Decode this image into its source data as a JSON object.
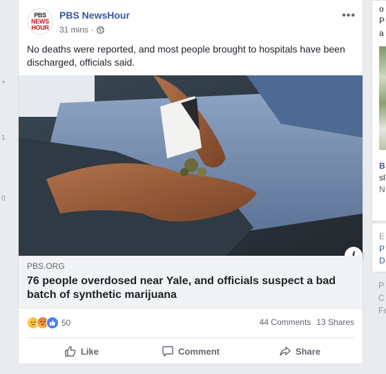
{
  "left_gutter": [
    "+",
    "1",
    "0"
  ],
  "post": {
    "page_name": "PBS NewsHour",
    "logo_line1": "PBS",
    "logo_line2": "NEWS",
    "logo_line3": "HOUR",
    "time": "31 mins",
    "dot": "·",
    "audience_icon": "globe-icon",
    "more_label": "•••",
    "caption": "No deaths were reported, and most people brought to hospitals have been discharged, officials said.",
    "info_label": "i",
    "link": {
      "domain": "PBS.ORG",
      "title": "76 people overdosed near Yale, and officials suspect a bad batch of synthetic marijuana"
    },
    "reaction_count": "50",
    "reaction_types": [
      "sad",
      "angry",
      "like"
    ],
    "comments": "44 Comments",
    "shares": "13 Shares",
    "actions": {
      "like": "Like",
      "comment": "Comment",
      "share": "Share"
    },
    "colors": {
      "page_name": "#365899",
      "like_blue": "#4a7ff2",
      "pbs_red": "#c4161c"
    }
  },
  "right_column": {
    "line1": "o",
    "line2": "P",
    "line3": "a",
    "line4": "B",
    "line5": "sl",
    "line6": "N",
    "line7": "E",
    "line8": "P",
    "line9": "D",
    "line10": "P",
    "line11": "C",
    "line12": "Fa"
  }
}
